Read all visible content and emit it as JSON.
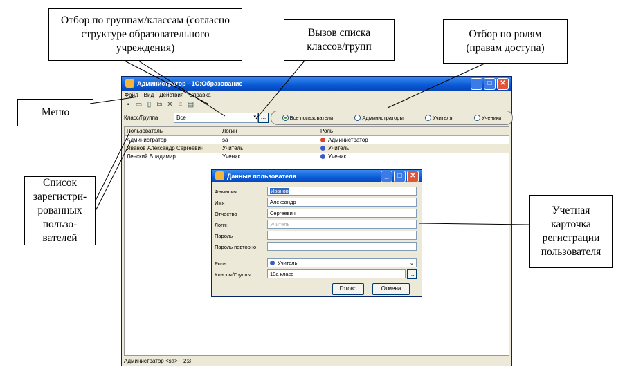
{
  "annotations": {
    "group_filter": "Отбор по группам/классам (согласно структуре образовательного учреждения)",
    "group_list_call": "Вызов списка классов/групп",
    "role_filter": "Отбор по ролям (правам доступа)",
    "menu": "Меню",
    "user_list": "Список зарегистри-рованных пользо-вателей",
    "user_card": "Учетная карточка регистрации пользователя"
  },
  "window": {
    "title": "Администратор - 1С:Образование",
    "menu": [
      "Файл",
      "Вид",
      "Действия",
      "Справка"
    ],
    "toolbar_icons": [
      "save-icon",
      "open-icon",
      "new-icon",
      "copy-icon",
      "delete-icon",
      "list-icon",
      "properties-icon"
    ],
    "filter_label": "Класс/Группа",
    "filter_value": "Все",
    "filter_button": "…",
    "radios": [
      "Все пользователи",
      "Администраторы",
      "Учителя",
      "Ученики"
    ],
    "radio_selected": 0,
    "columns": [
      "Пользователь",
      "Логин",
      "Роль"
    ],
    "rows": [
      {
        "user": "Администратор",
        "login": "sa",
        "role": "Администратор",
        "role_color": "#d9442a"
      },
      {
        "user": "Иванов Александр Сергеевич",
        "login": "Учитель",
        "role": "Учитель",
        "role_color": "#3a5bc7"
      },
      {
        "user": "Ленский Владимир",
        "login": "Ученик",
        "role": "Ученик",
        "role_color": "#3a5bc7"
      }
    ],
    "selected_row": 1,
    "status": "Администратор <sa>",
    "status_count": "2:3"
  },
  "dialog": {
    "title": "Данные пользователя",
    "fields": [
      {
        "label": "Фамилия",
        "value": "Иванов"
      },
      {
        "label": "Имя",
        "value": "Александр"
      },
      {
        "label": "Отчество",
        "value": "Сергеевич"
      },
      {
        "label": "Логин",
        "value": "Учитель"
      },
      {
        "label": "Пароль",
        "value": ""
      },
      {
        "label": "Пароль повторно",
        "value": ""
      }
    ],
    "role_label": "Роль",
    "role_value": "Учитель",
    "classes_label": "Классы/Группы",
    "classes_value": "10а класс",
    "ok": "Готово",
    "cancel": "Отмена"
  }
}
